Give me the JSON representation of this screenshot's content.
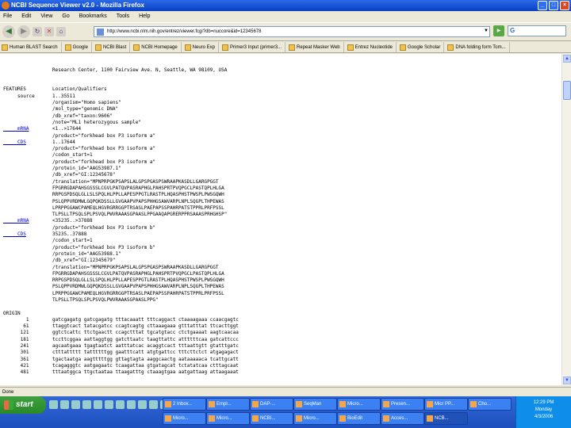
{
  "window": {
    "title": "NCBI Sequence Viewer v2.0 - Mozilla Firefox"
  },
  "menu": [
    "File",
    "Edit",
    "View",
    "Go",
    "Bookmarks",
    "Tools",
    "Help"
  ],
  "address": {
    "url": "http://www.ncbi.nlm.nih.gov/entrez/viewer.fcgi?db=nuccore&id=12345678"
  },
  "bookmarks": [
    "Human BLAST Search",
    "Google",
    "NCBI Blast",
    "NCBI Homepage",
    "Neuro Exp",
    "Primer3 Input (primer3...",
    "Repeat Masker Web",
    "Entrez Nucleotide",
    "Google Scholar",
    "DNA folding form Tom..."
  ],
  "record": {
    "address_line": "Research Center, 1100 Fairview Ave. N, Seattle, WA 98109, USA",
    "lines": [
      {
        "label": "FEATURES",
        "text": "Location/Qualifiers",
        "link": false
      },
      {
        "label": "     source",
        "text": "1..35511",
        "link": false
      },
      {
        "label": "",
        "text": "/organism=\"Homo sapiens\"",
        "link": false
      },
      {
        "label": "",
        "text": "/mol_type=\"genomic DNA\"",
        "link": false
      },
      {
        "label": "",
        "text": "/db_xref=\"taxon:9606\"",
        "link": false
      },
      {
        "label": "",
        "text": "/note=\"ML1 heterozygous sample\"",
        "link": false
      },
      {
        "label": "     mRNA",
        "text": "<1..>17644",
        "link": true
      },
      {
        "label": "",
        "text": "/product=\"forkhead box P3 isoform a\"",
        "link": false
      },
      {
        "label": "     CDS",
        "text": "1..17644",
        "link": true
      },
      {
        "label": "",
        "text": "/product=\"forkhead box P3 isoform a\"",
        "link": false
      },
      {
        "label": "",
        "text": "/codon_start=1",
        "link": false
      },
      {
        "label": "",
        "text": "/product=\"forkhead box P3 isoform a\"",
        "link": false
      },
      {
        "label": "",
        "text": "/protein_id=\"AAG53987.1\"",
        "link": false
      },
      {
        "label": "",
        "text": "/db_xref=\"GI:12345678\"",
        "link": false
      },
      {
        "label": "",
        "text": "/translation=\"MPNPRPGKPSAPSLALGPSPGASPSWRAAPKASDLLGARGPGGT",
        "link": false
      },
      {
        "label": "",
        "text": "FPGRRGDAPAHSGSSSLCGVLPATQVPASRAPHGLPAHSPRTPVQPGCLPASTQPLHLGA",
        "link": false
      },
      {
        "label": "",
        "text": "RRPGSPDSQLGLLSLSPQLHLPPLLAPESPPGTLRASTPLHQASPHSTPWSPLPWSGQWH",
        "link": false
      },
      {
        "label": "",
        "text": "PSLQPPVRDMWLGQPQKDSSLLGVGAAPVPAPSPHHGSAWVARPLNPLSQGPLTHPEWAS",
        "link": false
      },
      {
        "label": "",
        "text": "LPRPPGGAWCPAMEQLHGVRGRRGGPTRSASLPAEPAPSSPAHRPATSTPPRLPRFPSSL",
        "link": false
      },
      {
        "label": "",
        "text": "TLPSLLTPSQLSPLPSVQLPWVRAAASGPAASLPPGAAQAPGRERPPRSAAASPRHGHSP\"",
        "link": false
      },
      {
        "label": "     mRNA",
        "text": "<35235..>37888",
        "link": true
      },
      {
        "label": "",
        "text": "/product=\"forkhead box P3 isoform b\"",
        "link": false
      },
      {
        "label": "     CDS",
        "text": "35235..37888",
        "link": true
      },
      {
        "label": "",
        "text": "/codon_start=1",
        "link": false
      },
      {
        "label": "",
        "text": "/product=\"forkhead box P3 isoform b\"",
        "link": false
      },
      {
        "label": "",
        "text": "/protein_id=\"AAG53988.1\"",
        "link": false
      },
      {
        "label": "",
        "text": "/db_xref=\"GI:12345679\"",
        "link": false
      },
      {
        "label": "",
        "text": "/translation=\"MPNPRPGKPSAPSLALGPSPGASPSWRAAPKASDLLGARGPGGT",
        "link": false
      },
      {
        "label": "",
        "text": "FPGRRGDAPAHSGSSSLCGVLPATQVPASRAPHGLPAHSPRTPVQPGCLPASTQPLHLGA",
        "link": false
      },
      {
        "label": "",
        "text": "RRPGSPDSQLGLLSLSPQLHLPPLLAPESPPGTLRASTPLHQASPHSTPWSPLPWSGQWH",
        "link": false
      },
      {
        "label": "",
        "text": "PSLQPPVRDMWLGQPQKDSSLLGVGAAPVPAPSPHHGSAWVARPLNPLSQGPLTHPEWAS",
        "link": false
      },
      {
        "label": "",
        "text": "LPRPPGGAWCPAMEQLHGVRGRRGGPTRSASLPAEPAPSSPAHRPATSTPPRLPRFPSSL",
        "link": false
      },
      {
        "label": "",
        "text": "TLPSLLTPSQLSPLPSVQLPWVRAAASGPAASLPPG\"",
        "link": false
      },
      {
        "label": "",
        "text": "",
        "link": false
      },
      {
        "label": "ORIGIN",
        "text": "",
        "link": false
      },
      {
        "label": "        1",
        "text": "gatcgagatg gatcgagatg tttacaaatt tttcaggact ctaaaagaaa ccaacgagtc",
        "link": false
      },
      {
        "label": "       61",
        "text": "ttaggtcact tatacgatcc ccagtcagtg cttaaagaaa gtttatttat ttcacttggt",
        "link": false
      },
      {
        "label": "      121",
        "text": "ggtctcattc ttctgaactt ccagctttat tgcatgtacc ctctgaaaat aagtcaacaa",
        "link": false
      },
      {
        "label": "      181",
        "text": "tccttcggaa aattaggtgg gatcttaatc taagttattc attttttcaa gatcattccc",
        "link": false
      },
      {
        "label": "      241",
        "text": "agcaatgaaa tgagtaatct aatttatcac acaggtcact tttaattgtt gtatttgatc",
        "link": false
      },
      {
        "label": "      301",
        "text": "ctttattttt tattttttgg gaatttcatt atgtgattcc tttcttctct atgagagact",
        "link": false
      },
      {
        "label": "      361",
        "text": "tgactaatga aagtttttgg gttagtagta aaggcaactg aataaaaaca tcattgcatt",
        "link": false
      },
      {
        "label": "      421",
        "text": "tcagagggtc aatgagaatc tcaagattaa gtgatagcat tctatatcaa ctttagcaat",
        "link": false
      },
      {
        "label": "      481",
        "text": "tttaatggca ttgctaataa ttaagatttg ctaaagtgaa aatgattaag attaagaaat",
        "link": false
      }
    ]
  },
  "status": "Done",
  "taskbar": {
    "start_label": "start",
    "tasks": [
      {
        "label": "2 Inbox..."
      },
      {
        "label": "Empl..."
      },
      {
        "label": "DAP-..."
      },
      {
        "label": "SeqMan"
      },
      {
        "label": "Micro..."
      },
      {
        "label": "Presen..."
      },
      {
        "label": "Micr PP..."
      },
      {
        "label": "Cho..."
      },
      {
        "label": "Micro..."
      },
      {
        "label": "Micro..."
      },
      {
        "label": "NCBI..."
      },
      {
        "label": "Micro..."
      },
      {
        "label": "BioEdit"
      },
      {
        "label": "Acces..."
      },
      {
        "label": "NCB..."
      }
    ],
    "clock": {
      "time": "12:29 PM",
      "day": "Monday",
      "date": "4/3/2006"
    }
  }
}
